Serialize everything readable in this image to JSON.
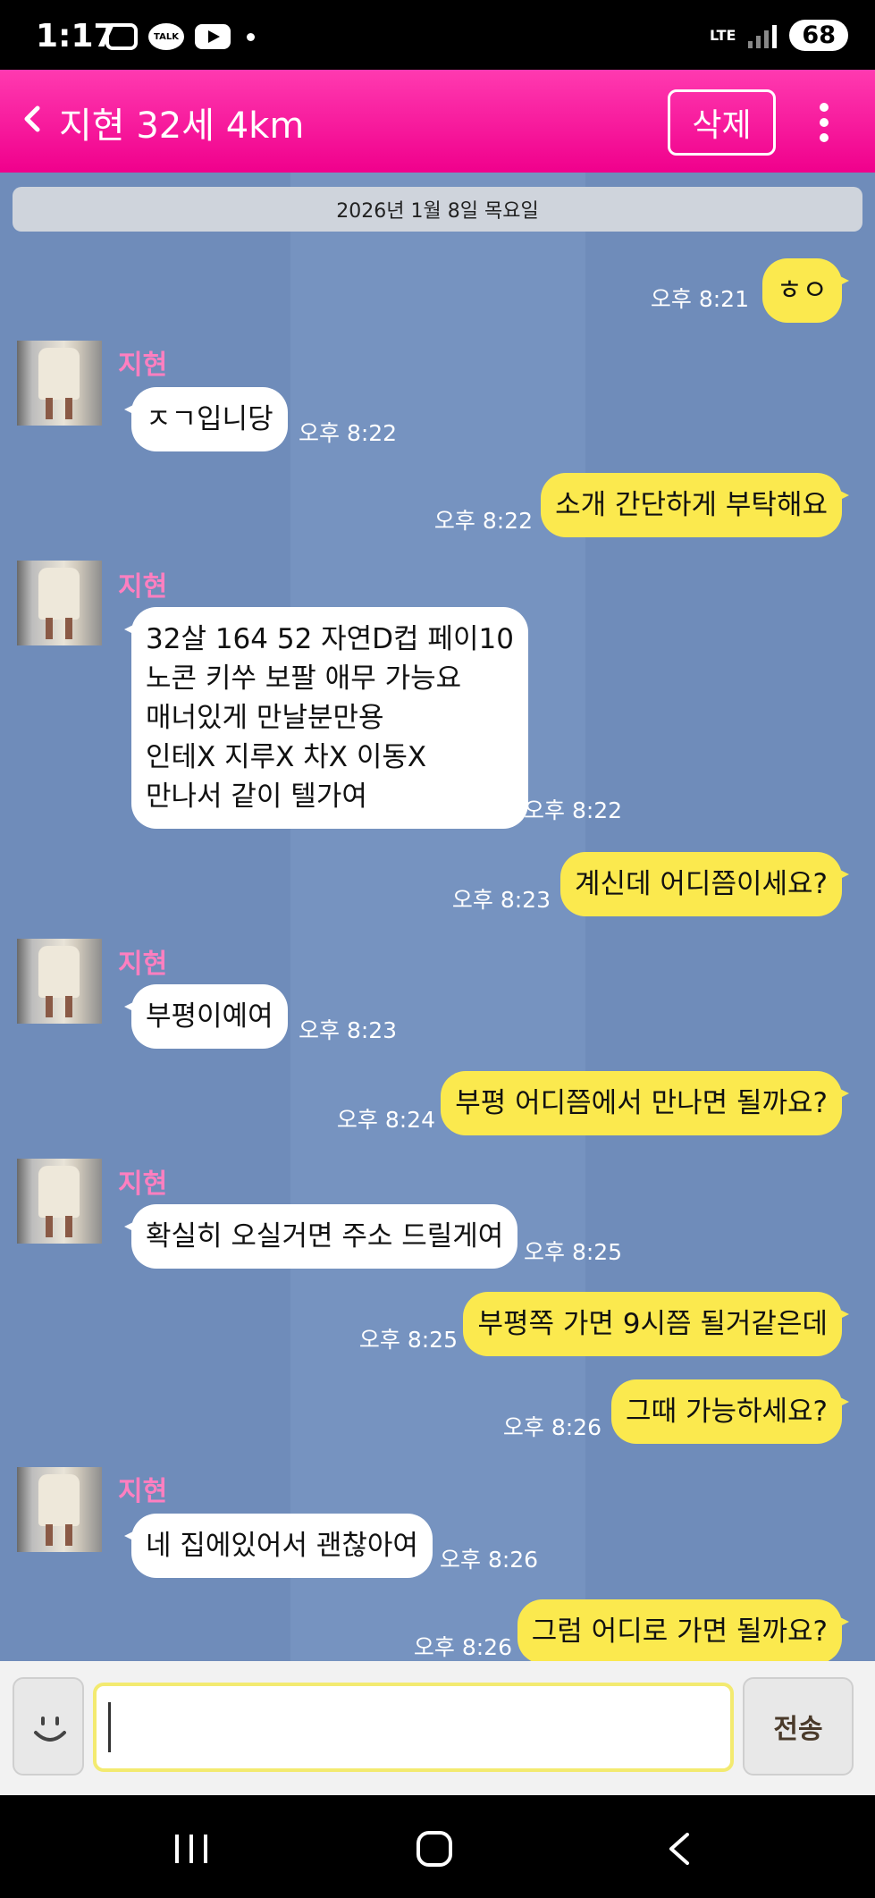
{
  "status_bar": {
    "time": "1:17",
    "talk_label": "TALK",
    "network": "LTE",
    "battery": "68",
    "icons": [
      "camera-icon",
      "talk-icon",
      "youtube-icon",
      "dot-icon",
      "signal-icon"
    ]
  },
  "header": {
    "title": "지현 32세 4km",
    "delete_label": "삭제",
    "back_icon": "chevron-left-icon",
    "more_icon": "more-vertical-icon",
    "bg_color": "#f0008c"
  },
  "chat": {
    "date": "2026년 1월 8일 목요일",
    "bg_color": "#6f8cba",
    "my_bubble_color": "#fbe94e",
    "sender_name_color": "#ff7fc0",
    "messages": [
      {
        "from": "me",
        "text": "ㅎㅇ",
        "time": "오후 8:21"
      },
      {
        "from": "other",
        "name": "지현",
        "text": "ㅈㄱ입니당",
        "time": "오후 8:22"
      },
      {
        "from": "me",
        "text": "소개 간단하게 부탁해요",
        "time": "오후 8:22"
      },
      {
        "from": "other",
        "name": "지현",
        "lines": [
          "32살 164 52 자연D컵 페이10",
          "노콘 키쑤 보팔 애무 가능요",
          "매너있게 만날분만용",
          "인테X 지루X 차X 이동X",
          "만나서 같이 텔가여"
        ],
        "time": "오후 8:22"
      },
      {
        "from": "me",
        "text": "계신데 어디쯤이세요?",
        "time": "오후 8:23"
      },
      {
        "from": "other",
        "name": "지현",
        "text": "부평이예여",
        "time": "오후 8:23"
      },
      {
        "from": "me",
        "text": "부평 어디쯤에서 만나면 될까요?",
        "time": "오후 8:24"
      },
      {
        "from": "other",
        "name": "지현",
        "text": "확실히 오실거면 주소 드릴게여",
        "time": "오후 8:25"
      },
      {
        "from": "me",
        "text": "부평쪽 가면 9시쯤 될거같은데",
        "time": "오후 8:25"
      },
      {
        "from": "me",
        "text": "그때 가능하세요?",
        "time": "오후 8:26"
      },
      {
        "from": "other",
        "name": "지현",
        "text": "네 집에있어서 괜찮아여",
        "time": "오후 8:26"
      },
      {
        "from": "me",
        "text": "그럼 어디로 가면 될까요?",
        "time": "오후 8:26"
      }
    ]
  },
  "input_bar": {
    "emoji_icon": "emoticon-icon",
    "input_value": "",
    "send_label": "전송"
  },
  "nav_bar": {
    "icons": [
      "recent-apps-icon",
      "home-icon",
      "back-icon"
    ]
  }
}
